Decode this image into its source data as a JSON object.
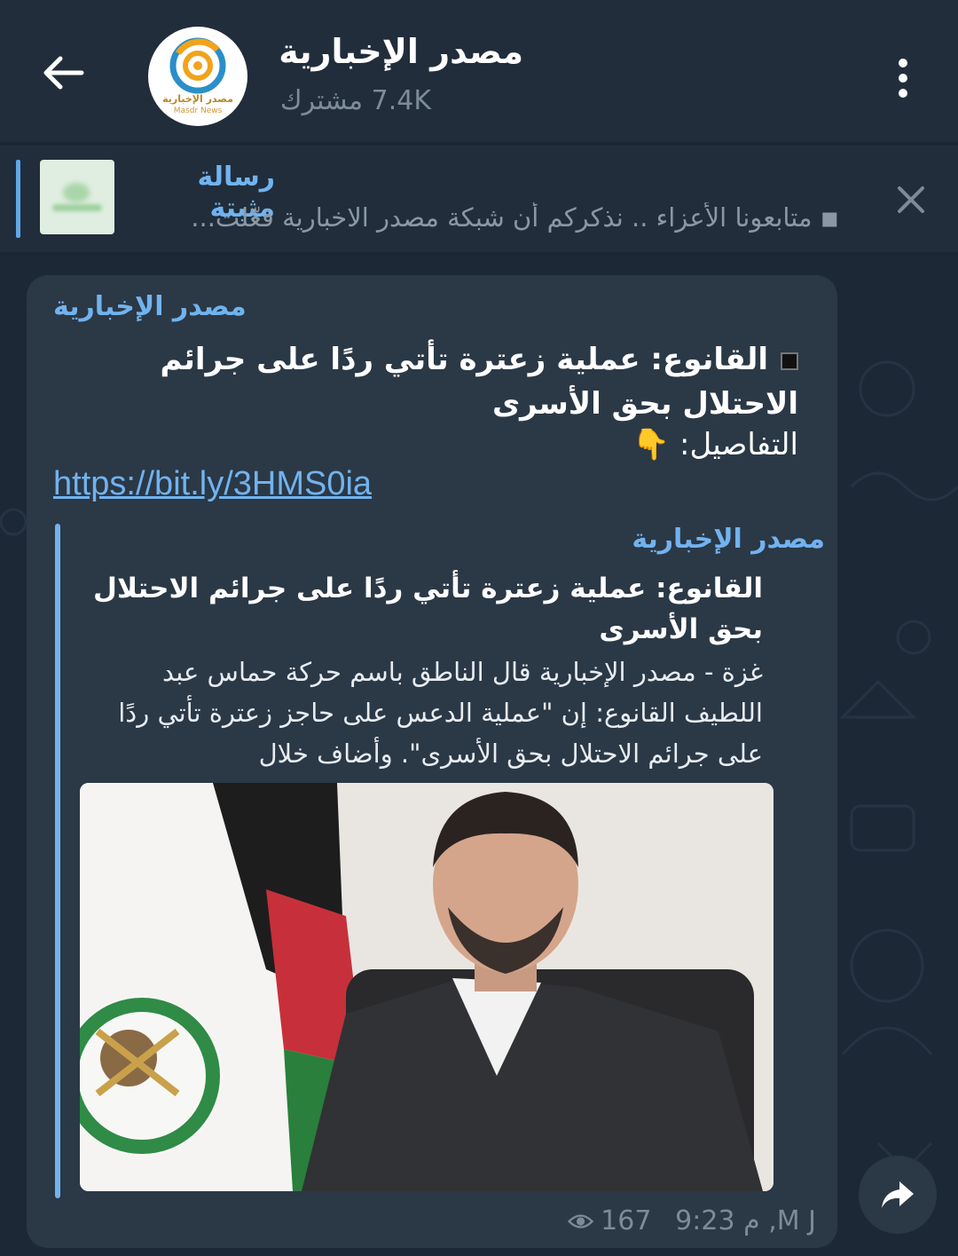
{
  "header": {
    "channel_title": "مصدر الإخبارية",
    "subscribers": "7.4K مشترك",
    "avatar_caption_ar": "مصدر الإخبارية",
    "avatar_caption_en": "Masdr News"
  },
  "pinned": {
    "title": "رسالة مثبتة",
    "text": "◾ متابعونا الأعزاء .. نذكركم أن شبكة مصدر الاخبارية فعّلت..."
  },
  "message": {
    "author": "مصدر الإخبارية",
    "headline": "القانوع: عملية زعترة تأتي ردًا على جرائم الاحتلال بحق الأسرى",
    "details": "التفاصيل: 👇",
    "link": "https://bit.ly/3HMS0ia",
    "preview": {
      "site": "مصدر الإخبارية",
      "title": "القانوع: عملية زعترة تأتي ردًا على جرائم الاحتلال بحق الأسرى",
      "description": "غزة - مصدر الإخبارية قال الناطق باسم حركة حماس عبد اللطيف القانوع: إن \"عملية الدعس على حاجز زعترة تأتي ردًا على جرائم الاحتلال بحق الأسرى\". وأضاف خلال"
    },
    "views": "167",
    "signature_time": "م 9:23 ,M J"
  },
  "colors": {
    "accent": "#71b3ef",
    "bubble": "#2b3846",
    "header": "#212d3b",
    "background": "#1d2836"
  },
  "icons": [
    "back-arrow-icon",
    "more-vert-icon",
    "close-icon",
    "eye-icon",
    "share-icon"
  ]
}
